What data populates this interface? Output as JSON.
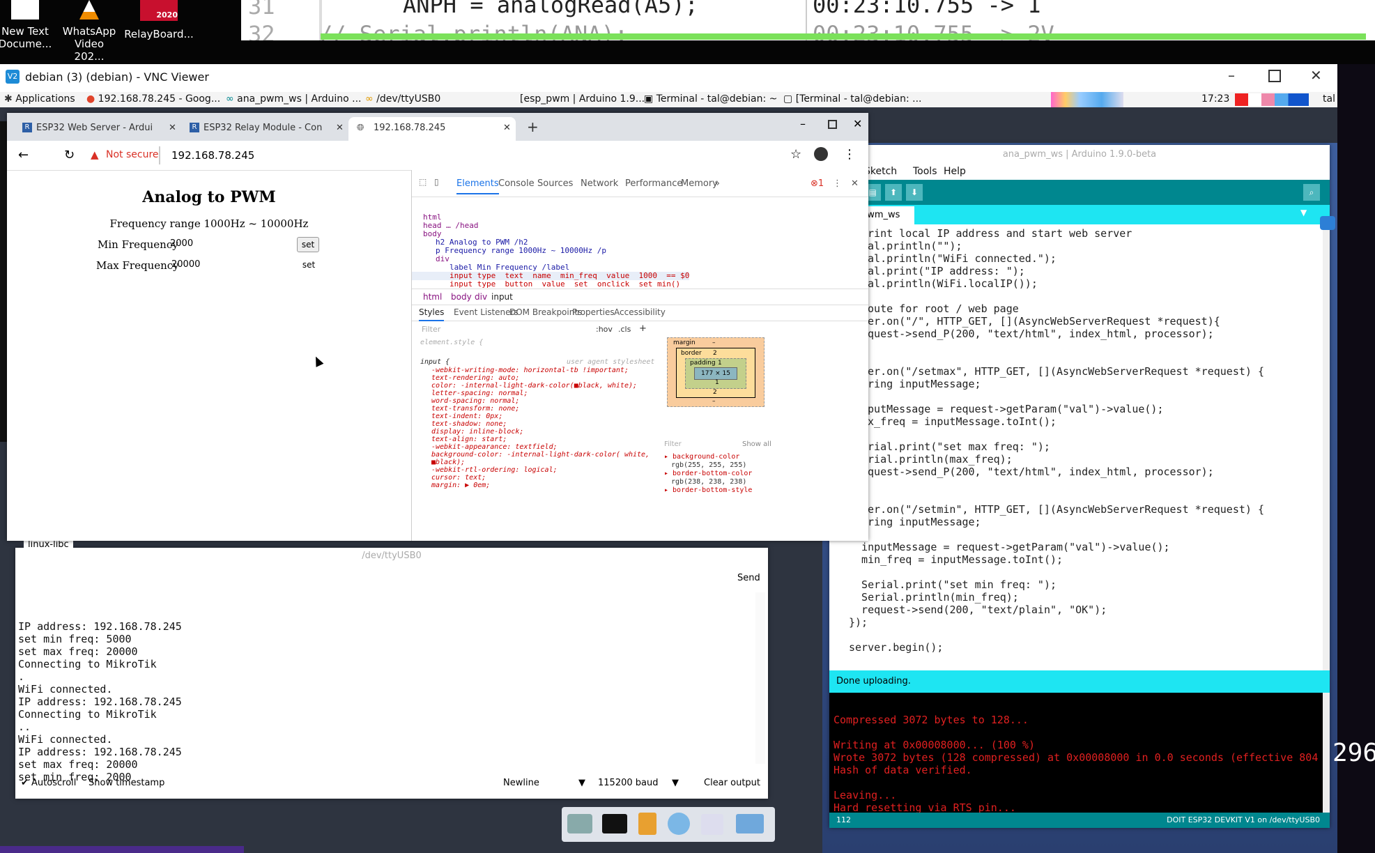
{
  "desktop": {
    "icons": [
      {
        "label": "New Text\nDocume...",
        "name": "new-text-document"
      },
      {
        "label": "WhatsApp\nVideo 202...",
        "name": "whatsapp-video"
      },
      {
        "label": "RelayBoard...",
        "name": "relayboard"
      }
    ],
    "editor_lines": [
      {
        "num": "31",
        "code": "ANPH = analogRead(A5);"
      },
      {
        "num": "32",
        "code": "// Serial.println(ANA);"
      }
    ],
    "serial_top": [
      "00:23:10.755 -> 1",
      "00:23:10.755 -> 2V"
    ],
    "right_edge": "296"
  },
  "vnc": {
    "title": "debian (3) (debian) - VNC Viewer",
    "taskbar": {
      "applications": "Applications",
      "items": [
        "192.168.78.245 - Goog...",
        "ana_pwm_ws | Arduino ...",
        "/dev/ttyUSB0",
        "[esp_pwm | Arduino 1.9...",
        "Terminal - tal@debian: ~",
        "[Terminal - tal@debian: ..."
      ],
      "clock": "17:23",
      "user": "tal"
    }
  },
  "chrome": {
    "tabs": [
      "ESP32 Web Server - Ardui",
      "ESP32 Relay Module - Con",
      "192.168.78.245"
    ],
    "security": "Not secure",
    "url": "192.168.78.245",
    "page": {
      "title": "Analog to PWM",
      "subtitle": "Frequency range 1000Hz ~ 10000Hz",
      "min_label": "Min Frequency",
      "min_value": "2000",
      "max_label": "Max Frequency",
      "max_value": "20000",
      "set_label": "set"
    },
    "devtools": {
      "tabs": [
        "Elements",
        "Console",
        "Sources",
        "Network",
        "Performance",
        "Memory"
      ],
      "error_count": "1",
      "dom": [
        "html",
        "head … /head",
        "body",
        "h2 Analog to PWM /h2",
        "p Frequency range 1000Hz ~ 10000Hz /p",
        "div",
        "label Min Frequency /label",
        "input type  text  name  min_freq  value  1000  == $0",
        "input type  button  value  set  onclick  set min()"
      ],
      "breadcrumb": [
        "html",
        "body",
        "div",
        "input"
      ],
      "subtabs": [
        "Styles",
        "Event Listeners",
        "DOM Breakpoints",
        "Properties",
        "Accessibility"
      ],
      "filter": "Filter",
      "hov": ":hov",
      "cls": ".cls",
      "element_style": "element.style {",
      "rule_selector": "input {",
      "rule_source": "user agent stylesheet",
      "styles": [
        "-webkit-writing-mode: horizontal-tb !important;",
        "text-rendering: auto;",
        "color: -internal-light-dark-color(■black, white);",
        "letter-spacing: normal;",
        "word-spacing: normal;",
        "text-transform: none;",
        "text-indent: 0px;",
        "text-shadow: none;",
        "display: inline-block;",
        "text-align: start;",
        "-webkit-appearance: textfield;",
        "background-color: -internal-light-dark-color( white,",
        "■black);",
        "-webkit-rtl-ordering: logical;",
        "cursor: text;",
        "margin: ▶ 0em;"
      ],
      "box": {
        "margin": "margin",
        "border": "border",
        "padding": "padding",
        "size": "177 × 15",
        "dash": "–",
        "two": "2",
        "one": "1"
      },
      "computed_filter": "Filter",
      "show_all": "Show all",
      "computed": [
        {
          "prop": "background-color",
          "val": "rgb(255, 255, 255)"
        },
        {
          "prop": "border-bottom-color",
          "val": "rgb(238, 238, 238)"
        },
        {
          "prop": "border-bottom-style",
          "val": ""
        }
      ]
    }
  },
  "arduino": {
    "title": "ana_pwm_ws | Arduino 1.9.0-beta",
    "menus": [
      "Sketch",
      "Tools",
      "Help"
    ],
    "tab": "pwm_ws",
    "code": [
      "Print local IP address and start web server",
      "ial.println(\"\");",
      "ial.println(\"WiFi connected.\");",
      "ial.print(\"IP address: \");",
      "ial.println(WiFi.localIP());",
      "",
      "Route for root / web page",
      "ver.on(\"/\", HTTP_GET, [](AsyncWebServerRequest *request){",
      "equest->send_P(200, \"text/html\", index_html, processor);",
      "",
      "",
      "ver.on(\"/setmax\", HTTP_GET, [](AsyncWebServerRequest *request) {",
      "tring inputMessage;",
      "",
      "nputMessage = request->getParam(\"val\")->value();",
      "ax_freq = inputMessage.toInt();",
      "",
      "erial.print(\"set max freq: \");",
      "erial.println(max_freq);",
      "equest->send_P(200, \"text/html\", index_html, processor);",
      "",
      "",
      "ver.on(\"/setmin\", HTTP_GET, [](AsyncWebServerRequest *request) {",
      "tring inputMessage;",
      "",
      "  inputMessage = request->getParam(\"val\")->value();",
      "  min_freq = inputMessage.toInt();",
      "",
      "  Serial.print(\"set min freq: \");",
      "  Serial.println(min_freq);",
      "  request->send(200, \"text/plain\", \"OK\");",
      "});",
      "",
      "server.begin();"
    ],
    "status": "Done uploading.",
    "console": [
      "Compressed 3072 bytes to 128...",
      "",
      "Writing at 0x00008000... (100 %)",
      "Wrote 3072 bytes (128 compressed) at 0x00008000 in 0.0 seconds (effective 804",
      "Hash of data verified.",
      "",
      "Leaving...",
      "Hard resetting via RTS pin..."
    ],
    "line_number": "112",
    "board": "DOIT ESP32 DEVKIT V1 on /dev/ttyUSB0"
  },
  "serial_monitor": {
    "title": "/dev/ttyUSB0",
    "send": "Send",
    "behind_label": "linux-libc",
    "lines": [
      "IP address: 192.168.78.245",
      "set min freq: 5000",
      "set max freq: 20000",
      "Connecting to MikroTik",
      ".",
      "WiFi connected.",
      "IP address: 192.168.78.245",
      "Connecting to MikroTik",
      "..",
      "WiFi connected.",
      "IP address: 192.168.78.245",
      "set max freq: 20000",
      "set min freq: 2000"
    ],
    "autoscroll": "Autoscroll",
    "timestamp": "Show timestamp",
    "line_ending": "Newline",
    "baud": "115200 baud",
    "clear": "Clear output"
  },
  "colors": {
    "accent_cyan": "#1ee5f2",
    "arduino_teal": "#00878f",
    "console_red": "#e02020",
    "chrome_red": "#d93025",
    "green_bar": "#7be15a"
  }
}
